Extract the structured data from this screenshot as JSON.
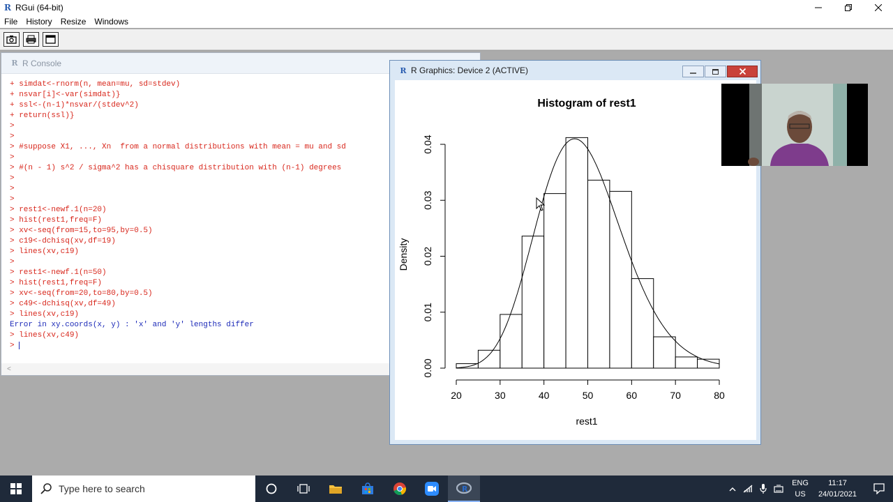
{
  "app": {
    "title": "RGui (64-bit)"
  },
  "menu": [
    "File",
    "History",
    "Resize",
    "Windows"
  ],
  "console": {
    "title": "R Console",
    "lines": [
      {
        "text": "+ simdat<-rnorm(n, mean=mu, sd=stdev)",
        "color": "red"
      },
      {
        "text": "+ nsvar[i]<-var(simdat)}",
        "color": "red"
      },
      {
        "text": "+ ssl<-(n-1)*nsvar/(stdev^2)",
        "color": "red"
      },
      {
        "text": "+ return(ssl)}",
        "color": "red"
      },
      {
        "text": ">",
        "color": "red"
      },
      {
        "text": ">",
        "color": "red"
      },
      {
        "text": "> #suppose X1, ..., Xn  from a normal distributions with mean = mu and sd",
        "color": "red"
      },
      {
        "text": ">",
        "color": "red"
      },
      {
        "text": "> #(n - 1) s^2 / sigma^2 has a chisquare distribution with (n-1) degrees",
        "color": "red"
      },
      {
        "text": ">",
        "color": "red"
      },
      {
        "text": ">",
        "color": "red"
      },
      {
        "text": ">",
        "color": "red"
      },
      {
        "text": "> rest1<-newf.1(n=20)",
        "color": "red"
      },
      {
        "text": "> hist(rest1,freq=F)",
        "color": "red"
      },
      {
        "text": "> xv<-seq(from=15,to=95,by=0.5)",
        "color": "red"
      },
      {
        "text": "> c19<-dchisq(xv,df=19)",
        "color": "red"
      },
      {
        "text": "> lines(xv,c19)",
        "color": "red"
      },
      {
        "text": ">",
        "color": "red"
      },
      {
        "text": "> rest1<-newf.1(n=50)",
        "color": "red"
      },
      {
        "text": "> hist(rest1,freq=F)",
        "color": "red"
      },
      {
        "text": "> xv<-seq(from=20,to=80,by=0.5)",
        "color": "red"
      },
      {
        "text": "> c49<-dchisq(xv,df=49)",
        "color": "red"
      },
      {
        "text": "> lines(xv,c19)",
        "color": "red"
      },
      {
        "text": "Error in xy.coords(x, y) : 'x' and 'y' lengths differ",
        "color": "blue"
      },
      {
        "text": "> lines(xv,c49)",
        "color": "red"
      }
    ],
    "prompt": ">"
  },
  "graphics": {
    "title": "R Graphics: Device 2 (ACTIVE)"
  },
  "chart_data": {
    "type": "bar",
    "title": "Histogram of rest1",
    "xlabel": "rest1",
    "ylabel": "Density",
    "xlim": [
      20,
      80
    ],
    "ylim": [
      0,
      0.04
    ],
    "x_ticks": [
      "20",
      "30",
      "40",
      "50",
      "60",
      "70",
      "80"
    ],
    "y_ticks": [
      "0.00",
      "0.01",
      "0.02",
      "0.03",
      "0.04"
    ],
    "bins": [
      {
        "from": 20,
        "to": 25,
        "density": 0.0008
      },
      {
        "from": 25,
        "to": 30,
        "density": 0.0032
      },
      {
        "from": 30,
        "to": 35,
        "density": 0.0096
      },
      {
        "from": 35,
        "to": 40,
        "density": 0.0236
      },
      {
        "from": 40,
        "to": 45,
        "density": 0.0312
      },
      {
        "from": 45,
        "to": 50,
        "density": 0.0412
      },
      {
        "from": 50,
        "to": 55,
        "density": 0.0336
      },
      {
        "from": 55,
        "to": 60,
        "density": 0.0316
      },
      {
        "from": 60,
        "to": 65,
        "density": 0.016
      },
      {
        "from": 65,
        "to": 70,
        "density": 0.0056
      },
      {
        "from": 70,
        "to": 75,
        "density": 0.002
      },
      {
        "from": 75,
        "to": 80,
        "density": 0.0016
      }
    ],
    "curve": "chi-square density, df = 49"
  },
  "taskbar": {
    "search_placeholder": "Type here to search",
    "lang_top": "ENG",
    "lang_bottom": "US",
    "time": "11:17",
    "date": "24/01/2021"
  },
  "colors": {
    "console_input": "#d8271c",
    "console_output": "#1c2ab8"
  }
}
